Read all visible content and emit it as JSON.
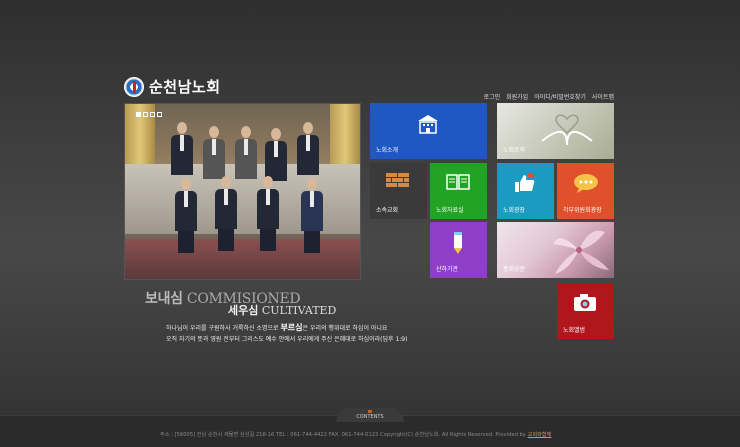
{
  "header": {
    "logo_text": "순천남노회",
    "util_links": [
      "로그인",
      "회원가입",
      "아이디/비밀번호찾기",
      "사이트맵"
    ]
  },
  "slideshow": {
    "indicator_count": 4,
    "active_index": 0
  },
  "tagline": {
    "line1_ko": "보내심",
    "line1_en": "COMMISIONED",
    "line2_ko": "세우심",
    "line2_en": "CULTIVATED",
    "verse_line1_pre": "하나님이 우리를 구원하사 거룩하신 소명으로",
    "verse_line1_hl": "부르심",
    "verse_line1_post": "은 우리의 행위대로 하심이 아니요",
    "verse_line2": "오직 자기의 뜻과 영원 전부터 그리스도 예수 안에서 우리에게 주신 은혜대로 하심이라(딤후 1:9)"
  },
  "tiles": [
    {
      "key": "intro",
      "label": "노회소개",
      "icon": "building-icon",
      "color": "#1f57c3"
    },
    {
      "key": "org",
      "label": "노회조직",
      "icon": "book-photo",
      "color": "#d9d9d0"
    },
    {
      "key": "churches",
      "label": "소속교회",
      "icon": "brick-icon",
      "color": "#3a3a3a"
    },
    {
      "key": "resources",
      "label": "노회자료실",
      "icon": "book-icon",
      "color": "#23a323"
    },
    {
      "key": "plaza",
      "label": "노회광장",
      "icon": "thumbs-up-icon",
      "color": "#1a9bbf"
    },
    {
      "key": "committees",
      "label": "각부위원회광장",
      "icon": "chat-icon",
      "color": "#e0502a"
    },
    {
      "key": "agencies",
      "label": "산하기관",
      "icon": "pencil-icon",
      "color": "#8f3fc7"
    },
    {
      "key": "notices",
      "label": "총회공문",
      "icon": "lily-photo",
      "color": "#e3c8d4"
    },
    {
      "key": "album",
      "label": "노회앨범",
      "icon": "camera-icon",
      "color": "#b0161b"
    }
  ],
  "footer": {
    "contents_label": "CONTENTS",
    "address": "주소 : [58005] 전남 순천시 제물면 삼삼길 218-16 TEL : 061-744-4422 FAX. 061-744-0123 Copyright(C) 순천남노회. All Rights Reserved. Provided by",
    "provider": "교회와함께"
  }
}
